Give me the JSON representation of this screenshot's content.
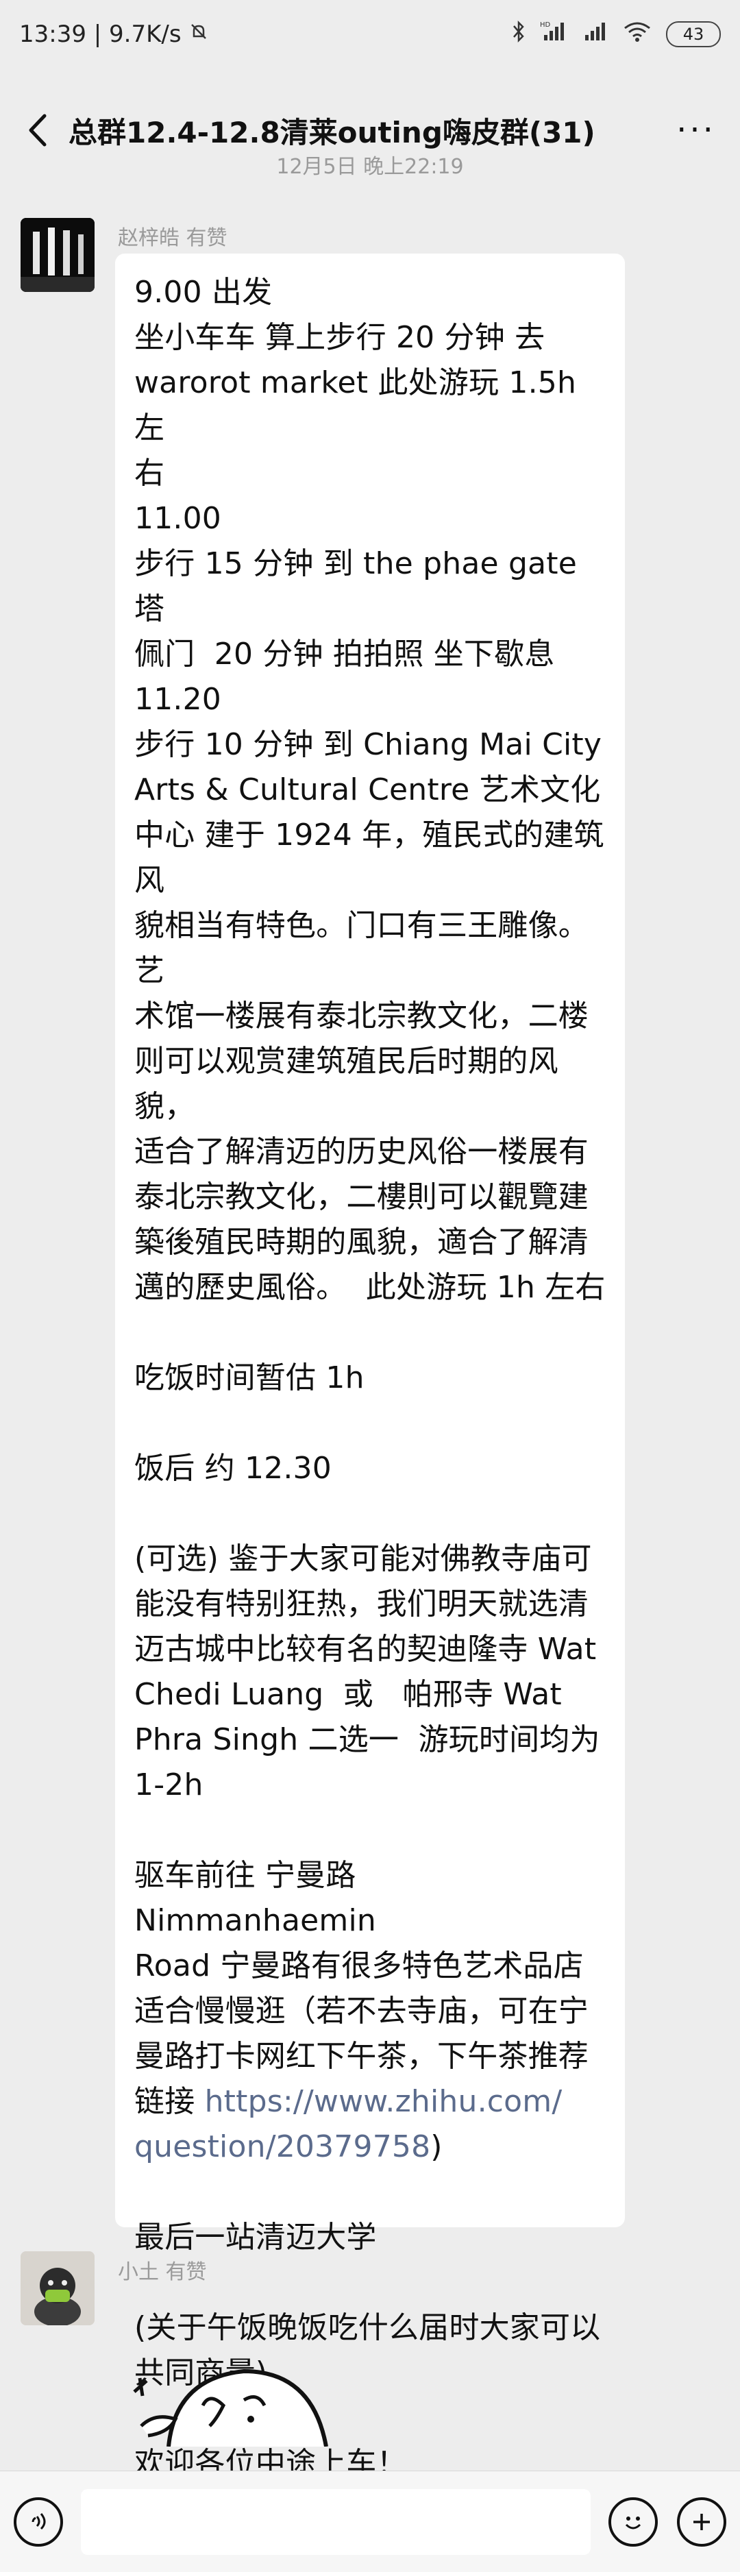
{
  "status_bar": {
    "time_speed": "13:39 | 9.7K/s",
    "battery": "43",
    "icons": [
      "mute-icon",
      "bluetooth-icon",
      "signal-hd-icon",
      "signal-icon",
      "wifi-icon",
      "battery-icon"
    ]
  },
  "header": {
    "title": "总群12.4-12.8清莱outing嗨皮群(31)",
    "more": "···"
  },
  "timestamp": "12月5日 晚上22:19",
  "messages": [
    {
      "sender": "赵梓皓 有赞",
      "lines": [
        "9.00 出发",
        "坐小车车 算上步行 20 分钟 去",
        "warorot market 此处游玩 1.5h 左",
        "右",
        "11.00",
        "步行 15 分钟 到 the phae gate 塔",
        "佩门  20 分钟 拍拍照 坐下歇息",
        "11.20",
        "步行 10 分钟 到 Chiang Mai City",
        "Arts & Cultural Centre 艺术文化",
        "中心 建于 1924 年，殖民式的建筑风",
        "貌相当有特色。门口有三王雕像。艺",
        "术馆一楼展有泰北宗教文化，二楼",
        "则可以观赏建筑殖民后时期的风貌，",
        "适合了解清迈的历史风俗一楼展有",
        "泰北宗教文化，二樓則可以觀覽建",
        "築後殖民時期的風貌，適合了解清",
        "邁的歷史風俗。  此处游玩 1h 左右",
        "",
        "吃饭时间暂估 1h",
        "",
        "饭后 约 12.30",
        "",
        "(可选) 鉴于大家可能对佛教寺庙可",
        "能没有特别狂热，我们明天就选清",
        "迈古城中比较有名的契迪隆寺 Wat",
        "Chedi Luang  或   帕邢寺 Wat",
        "Phra Singh 二选一  游玩时间均为",
        "1-2h",
        "",
        "驱车前往 宁曼路 Nimmanhaemin",
        "Road 宁曼路有很多特色艺术品店",
        "适合慢慢逛（若不去寺庙，可在宁",
        "曼路打卡网红下午茶，下午茶推荐",
        "链接 "
      ],
      "link_line1": "https://www.zhihu.com/",
      "link_line2": "question/20379758",
      "link_suffix": ")",
      "lines_after": [
        "",
        "最后一站清迈大学",
        "",
        "(关于午饭晚饭吃什么届时大家可以",
        "共同商量)",
        "",
        "欢迎各位中途上车！"
      ]
    },
    {
      "sender": "小土 有赞",
      "sticker": "sticker-image"
    }
  ],
  "input_bar": {
    "voice_icon": "voice-icon",
    "emoji_icon": "emoji-icon",
    "plus_icon": "plus-icon"
  }
}
